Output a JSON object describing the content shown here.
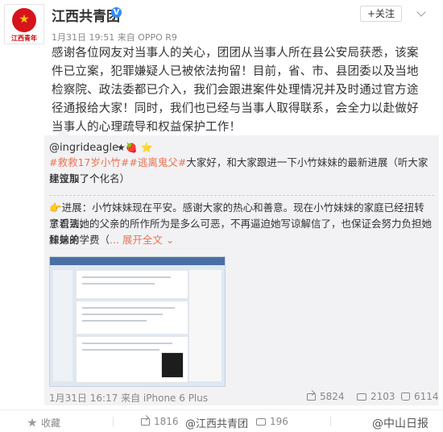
{
  "header": {
    "avatar_text": "江西青年",
    "username": "江西共青团",
    "verified_mark": "V",
    "follow_label": "+关注",
    "meta": "1月31日 19:51 来自 OPPO R9"
  },
  "main_text": "感谢各位网友对当事人的关心，团团从当事人所在县公安局获悉，该案件已立案，犯罪嫌疑人已被依法拘留！目前，省、市、县团委以及当地检察院、政法委都已介入，我们会跟进案件处理情况并及时通过官方途径通报给大家！同时，我们也已经与当事人取得联系，会全力以赴做好当事人的心理疏导和权益保护工作！",
  "quote": {
    "author": "@ingrideagle",
    "author_emojis": "★🍓 ⭐",
    "tag1": "#救救17岁小竹#",
    "tag2": "#逃离鬼父#",
    "line1_rest": "大家好，和大家跟进一下小竹妹妹的最新进展（听大家建议加了个",
    "line2": "标签取了个化名）",
    "para2_line1": "👉进展：小竹妹妹现在平安。感谢大家的热心和善意。现在小竹妹妹的家庭已经扭转了看法，",
    "para2_line2": "意识到她的父亲的所作所为是多么可恶，不再逼迫她写谅解信了，也保证会努力负担她和弟弟",
    "para2_line3": "妹妹的学费（",
    "expand_link": "... 展开全文 ⌄",
    "timestamp": "1月31日 16:17 来自 iPhone 6 Plus",
    "shares": "5824",
    "comments": "2103",
    "likes": "6114"
  },
  "bottom": {
    "favorite": "收藏",
    "reposts": "1816",
    "comments": "196",
    "watermark1": "@江西共青团",
    "watermark2": "@中山日报"
  }
}
